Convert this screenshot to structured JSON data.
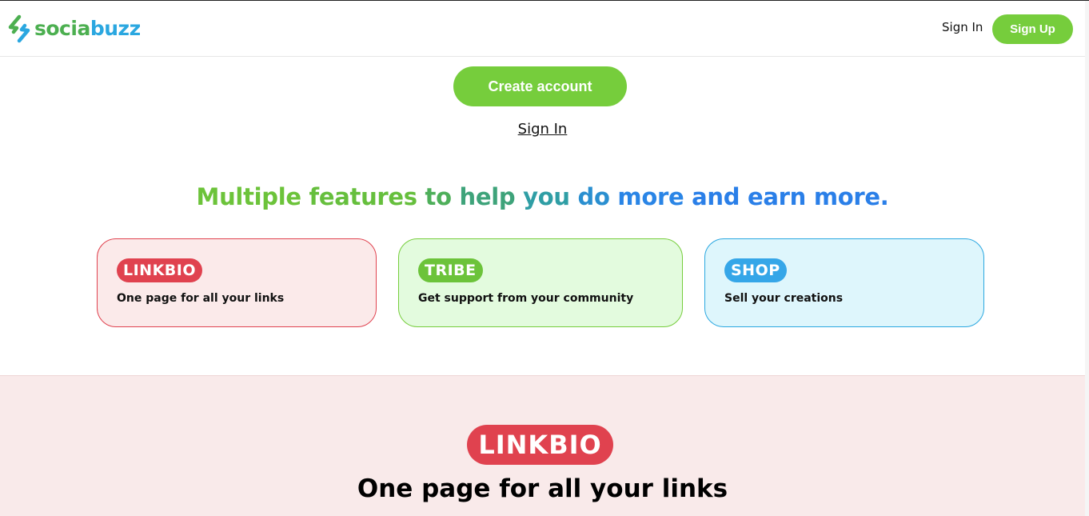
{
  "header": {
    "logo": {
      "part1": "socia",
      "part2": "buzz"
    },
    "sign_in_label": "Sign In",
    "sign_up_label": "Sign Up"
  },
  "hero": {
    "create_account_label": "Create account",
    "sign_in_link": "Sign In",
    "headline_words": [
      {
        "text": "Multiple",
        "color": "#6cc33a"
      },
      {
        "text": "features",
        "color": "#66bf3d"
      },
      {
        "text": "to",
        "color": "#4eaf5a"
      },
      {
        "text": "help",
        "color": "#3ea37a"
      },
      {
        "text": "you",
        "color": "#2f9ea5"
      },
      {
        "text": "do",
        "color": "#2a8fd0"
      },
      {
        "text": "more",
        "color": "#2a85e6"
      },
      {
        "text": "and",
        "color": "#2a7fe8"
      },
      {
        "text": "earn",
        "color": "#2a7fe8"
      },
      {
        "text": "more.",
        "color": "#2a7fe8"
      }
    ]
  },
  "features": [
    {
      "badge": "LINKBIO",
      "description": "One page for all your links"
    },
    {
      "badge": "TRIBE",
      "description": "Get support from your community"
    },
    {
      "badge": "SHOP",
      "description": "Sell your creations"
    }
  ],
  "linkbio_section": {
    "badge": "LINKBIO",
    "title": "One page for all your links"
  },
  "colors": {
    "brand_green": "#76cd3c",
    "linkbio_red": "#e0424f",
    "shop_blue": "#35a6e8"
  }
}
